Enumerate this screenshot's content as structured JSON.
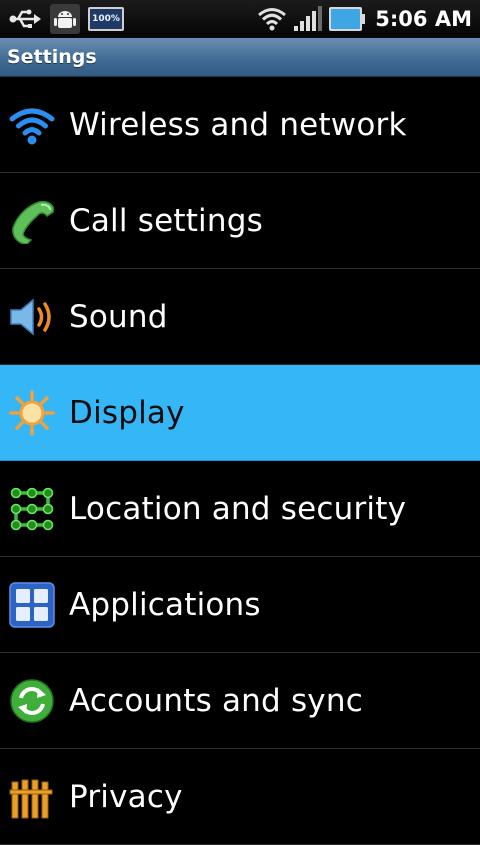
{
  "status_bar": {
    "time": "5:06 AM",
    "battery_badge": "100%",
    "icons": [
      "usb-icon",
      "android-debug-icon",
      "battery-percent-icon",
      "wifi-icon",
      "signal-icon",
      "battery-icon"
    ]
  },
  "title_bar": {
    "title": "Settings"
  },
  "settings": {
    "items": [
      {
        "label": "Wireless and network",
        "icon": "wifi-icon"
      },
      {
        "label": "Call settings",
        "icon": "phone-icon"
      },
      {
        "label": "Sound",
        "icon": "speaker-icon"
      },
      {
        "label": "Display",
        "icon": "sun-icon",
        "selected": true
      },
      {
        "label": "Location and security",
        "icon": "pattern-lock-icon"
      },
      {
        "label": "Applications",
        "icon": "applications-grid-icon"
      },
      {
        "label": "Accounts and sync",
        "icon": "sync-icon"
      },
      {
        "label": "Privacy",
        "icon": "privacy-icon"
      }
    ]
  },
  "colors": {
    "selected_row": "#35b6f6",
    "title_bar": "#3f6a93",
    "background": "#000000"
  }
}
